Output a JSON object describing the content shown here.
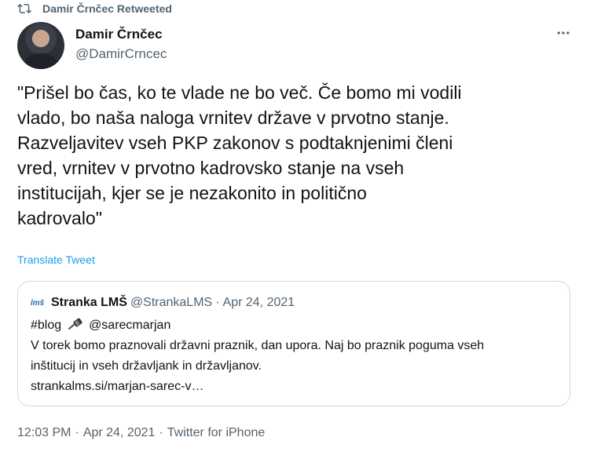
{
  "retweet": {
    "icon": "retweet-icon",
    "label": "Damir Črnčec Retweeted"
  },
  "author": {
    "name": "Damir Črnčec",
    "handle": "@DamirCrncec"
  },
  "more_icon": "more-options-icon",
  "tweet": {
    "text": "\"Prišel bo čas, ko te vlade ne bo več. Če bomo mi vodili\nvlado, bo naša naloga vrnitev države v prvotno stanje.\nRazveljavitev vseh PKP zakonov s podtaknjenimi členi\nvred, vrnitev v prvotno kadrovsko stanje na vseh\ninstitucijah, kjer se je nezakonito in politično\nkadrovalo\"",
    "translate_label": "Translate Tweet"
  },
  "quote": {
    "logo_text": "lmš",
    "name": "Stranka LMŠ",
    "handle": "@StrankaLMS",
    "separator": "·",
    "date": "Apr 24, 2021",
    "line1_prefix": "#blog",
    "line1_icon": "pushpin-icon",
    "line1_suffix": "@sarecmarjan",
    "line2": "V torek bomo praznovali državni praznik, dan upora. Naj bo praznik poguma vseh",
    "line3": "inštitucij in vseh državljank in državljanov.",
    "link": "strankalms.si/marjan-sarec-v…"
  },
  "footer": {
    "time": "12:03 PM",
    "separator": "·",
    "date": "Apr 24, 2021",
    "source": "Twitter for iPhone"
  },
  "colors": {
    "link": "#1d9bf0",
    "secondary_text": "#536471",
    "border": "#cfd9de",
    "text": "#0f1419"
  }
}
